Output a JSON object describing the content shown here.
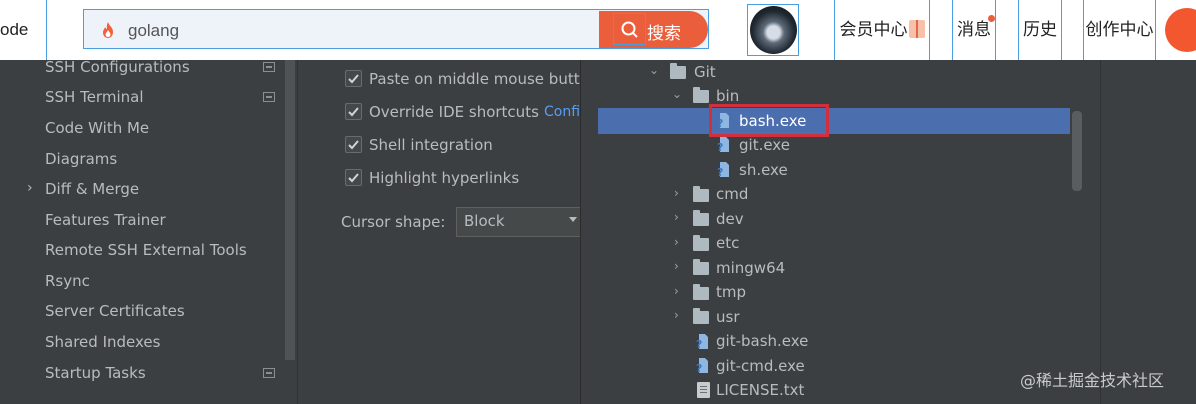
{
  "topbar": {
    "nav_left": "ode",
    "search": {
      "value": "golang",
      "button_label": "搜索"
    },
    "links": [
      "会员中心",
      "消息",
      "历史",
      "创作中心"
    ],
    "colors": {
      "accent": "#ea5e3c",
      "outline": "#4a9fe0"
    }
  },
  "sidebar": {
    "items": [
      {
        "label": "SSH Configurations",
        "badge": true
      },
      {
        "label": "SSH Terminal",
        "badge": true
      },
      {
        "label": "Code With Me",
        "badge": false
      },
      {
        "label": "Diagrams",
        "badge": false
      },
      {
        "label": "Diff & Merge",
        "badge": false,
        "expandable": true
      },
      {
        "label": "Features Trainer",
        "badge": false
      },
      {
        "label": "Remote SSH External Tools",
        "badge": false
      },
      {
        "label": "Rsync",
        "badge": false
      },
      {
        "label": "Server Certificates",
        "badge": false
      },
      {
        "label": "Shared Indexes",
        "badge": false
      },
      {
        "label": "Startup Tasks",
        "badge": true
      }
    ]
  },
  "settings": {
    "checkboxes": [
      {
        "label": "Paste on middle mouse butto",
        "checked": true
      },
      {
        "label": "Override IDE shortcuts",
        "checked": true,
        "link": "Confi"
      },
      {
        "label": "Shell integration",
        "checked": true
      },
      {
        "label": "Highlight hyperlinks",
        "checked": true
      }
    ],
    "cursor_shape_label": "Cursor shape:",
    "cursor_shape_value": "Block"
  },
  "tree": {
    "root": "Git",
    "bin": "bin",
    "bin_files": [
      "bash.exe",
      "git.exe",
      "sh.exe"
    ],
    "selected": "bash.exe",
    "folders": [
      "cmd",
      "dev",
      "etc",
      "mingw64",
      "tmp",
      "usr"
    ],
    "root_files": [
      "git-bash.exe",
      "git-cmd.exe",
      "LICENSE.txt"
    ],
    "selection_color": "#4b6eaf",
    "highlight_color": "#d22f3c"
  },
  "watermark": "@稀土掘金技术社区"
}
